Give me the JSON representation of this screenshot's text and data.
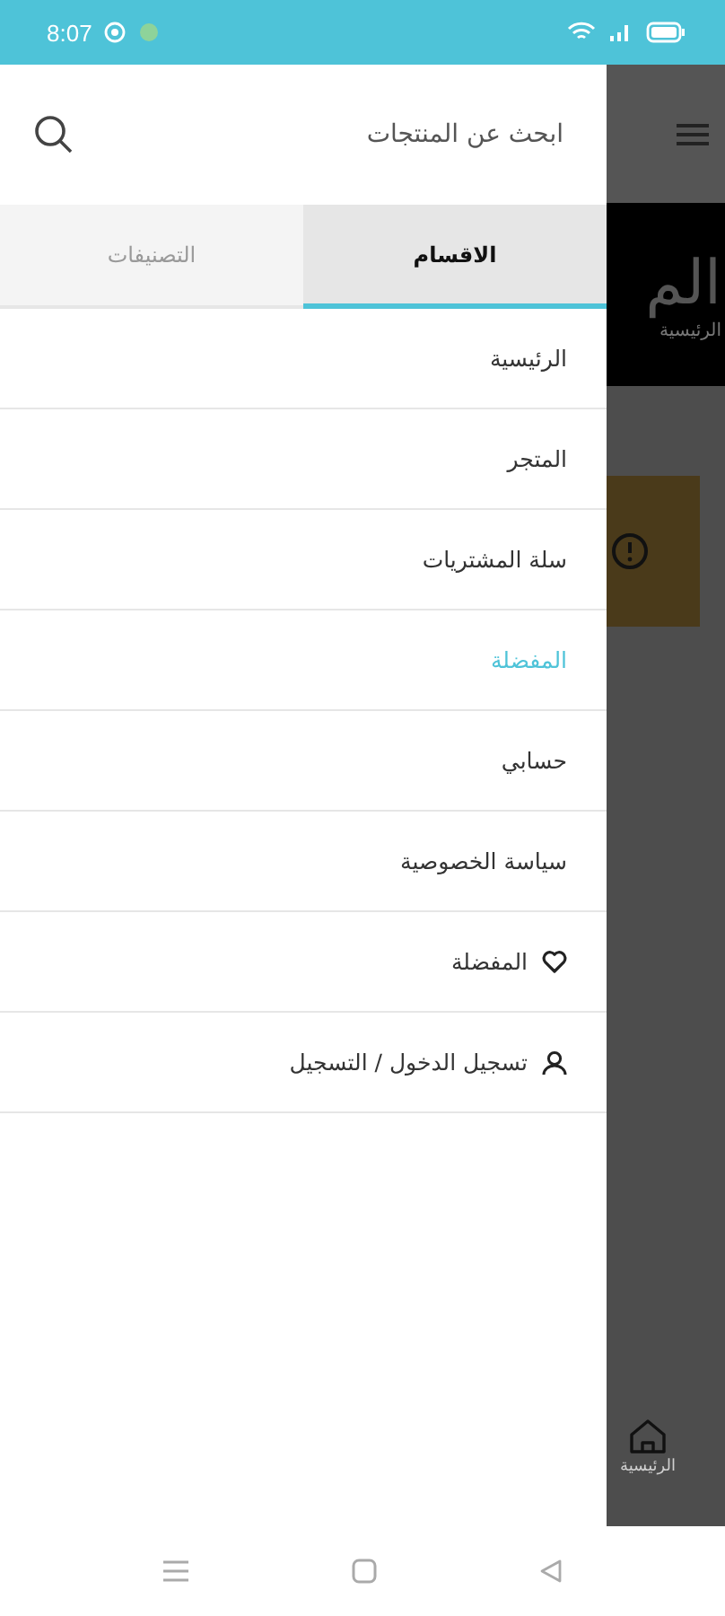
{
  "status_bar": {
    "time": "8:07"
  },
  "drawer": {
    "search": {
      "placeholder": "ابحث عن المنتجات"
    },
    "tabs": [
      {
        "label": "الاقسام",
        "selected": true
      },
      {
        "label": "التصنيفات",
        "selected": false
      }
    ],
    "items": [
      {
        "label": "الرئيسية",
        "kind": "plain",
        "selected": false
      },
      {
        "label": "المتجر",
        "kind": "plain",
        "selected": false
      },
      {
        "label": "سلة المشتريات",
        "kind": "plain",
        "selected": false
      },
      {
        "label": "المفضلة",
        "kind": "plain",
        "selected": true
      },
      {
        "label": "حسابي",
        "kind": "plain",
        "selected": false
      },
      {
        "label": "سياسة الخصوصية",
        "kind": "plain",
        "selected": false
      },
      {
        "label": "المفضلة",
        "kind": "heart",
        "selected": false
      },
      {
        "label": "تسجيل الدخول / التسجيل",
        "kind": "user",
        "selected": false
      }
    ]
  },
  "background_page": {
    "title": "الم",
    "subtitle": "الرئيسية",
    "bottom_nav_label": "الرئيسية"
  }
}
